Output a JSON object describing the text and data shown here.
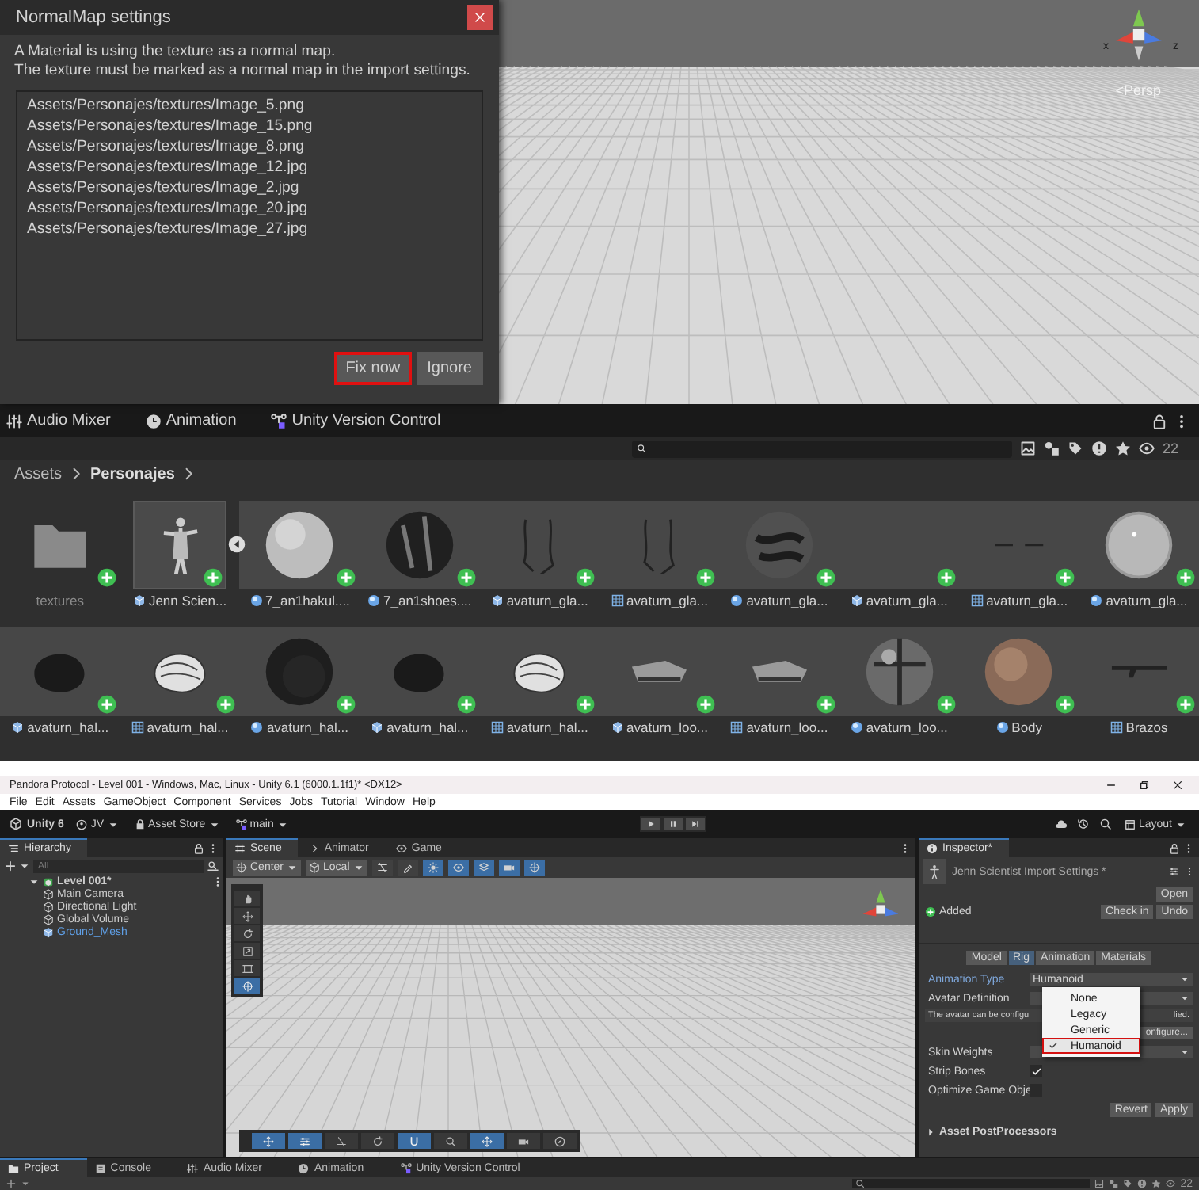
{
  "scene_preview": {
    "axis_labels": [
      "x",
      "z"
    ],
    "view_label": "<Persp"
  },
  "normal_map_dialog": {
    "title": "NormalMap settings",
    "message": [
      "A Material is using the texture as a normal map.",
      "The texture must be marked as a normal map in the import settings."
    ],
    "files": [
      "Assets/Personajes/textures/Image_5.png",
      "Assets/Personajes/textures/Image_15.png",
      "Assets/Personajes/textures/Image_8.png",
      "Assets/Personajes/textures/Image_12.jpg",
      "Assets/Personajes/textures/Image_2.jpg",
      "Assets/Personajes/textures/Image_20.jpg",
      "Assets/Personajes/textures/Image_27.jpg"
    ],
    "buttons": [
      {
        "label": "Fix now",
        "highlighted": true
      },
      {
        "label": "Ignore",
        "highlighted": false
      }
    ]
  },
  "project_panel": {
    "tabs": [
      {
        "label": "Audio Mixer"
      },
      {
        "label": "Animation"
      },
      {
        "label": "Unity Version Control"
      }
    ],
    "hidden_count": "22",
    "breadcrumb": [
      {
        "label": "Assets",
        "current": false
      },
      {
        "label": "Personajes",
        "current": true
      }
    ],
    "asset_rows": [
      [
        {
          "name": "textures",
          "kind": "folder",
          "grouped": false,
          "selected": false,
          "expanded": false
        },
        {
          "name": "Jenn Scien...",
          "kind": "prefab",
          "grouped": false,
          "selected": true,
          "expanded": true
        },
        {
          "name": "7_an1hakul....",
          "kind": "material",
          "grouped": true,
          "selected": false,
          "expanded": false
        },
        {
          "name": "7_an1shoes....",
          "kind": "material",
          "grouped": true,
          "selected": false,
          "expanded": false
        },
        {
          "name": "avaturn_gla...",
          "kind": "prefab",
          "grouped": true,
          "selected": false,
          "expanded": false
        },
        {
          "name": "avaturn_gla...",
          "kind": "texture",
          "grouped": true,
          "selected": false,
          "expanded": false
        },
        {
          "name": "avaturn_gla...",
          "kind": "material",
          "grouped": true,
          "selected": false,
          "expanded": false
        },
        {
          "name": "avaturn_gla...",
          "kind": "prefab",
          "grouped": true,
          "selected": false,
          "expanded": false
        },
        {
          "name": "avaturn_gla...",
          "kind": "texture",
          "grouped": true,
          "selected": false,
          "expanded": false
        },
        {
          "name": "avaturn_gla...",
          "kind": "material",
          "grouped": true,
          "selected": false,
          "expanded": false
        }
      ],
      [
        {
          "name": "avaturn_hal...",
          "kind": "prefab",
          "grouped": true,
          "selected": false,
          "expanded": false
        },
        {
          "name": "avaturn_hal...",
          "kind": "texture",
          "grouped": true,
          "selected": false,
          "expanded": false
        },
        {
          "name": "avaturn_hal...",
          "kind": "material",
          "grouped": true,
          "selected": false,
          "expanded": false
        },
        {
          "name": "avaturn_hal...",
          "kind": "prefab",
          "grouped": true,
          "selected": false,
          "expanded": false
        },
        {
          "name": "avaturn_hal...",
          "kind": "texture",
          "grouped": true,
          "selected": false,
          "expanded": false
        },
        {
          "name": "avaturn_loo...",
          "kind": "prefab",
          "grouped": true,
          "selected": false,
          "expanded": false
        },
        {
          "name": "avaturn_loo...",
          "kind": "texture",
          "grouped": true,
          "selected": false,
          "expanded": false
        },
        {
          "name": "avaturn_loo...",
          "kind": "material",
          "grouped": true,
          "selected": false,
          "expanded": false
        },
        {
          "name": "Body",
          "kind": "material",
          "grouped": true,
          "selected": false,
          "expanded": false
        },
        {
          "name": "Brazos",
          "kind": "texture",
          "grouped": true,
          "selected": false,
          "expanded": false
        }
      ]
    ]
  },
  "editor": {
    "title": "Pandora Protocol - Level 001 - Windows, Mac, Linux - Unity 6.1 (6000.1.1f1)* <DX12>",
    "menu": [
      "File",
      "Edit",
      "Assets",
      "GameObject",
      "Component",
      "Services",
      "Jobs",
      "Tutorial",
      "Window",
      "Help"
    ],
    "toolbar": {
      "version": "Unity 6",
      "account": "JV",
      "asset_store": "Asset Store",
      "branch": "main",
      "layout": "Layout"
    },
    "hierarchy": {
      "tab": "Hierarchy",
      "search_placeholder": "All",
      "tree": [
        {
          "label": "Level 001*",
          "expanded": true,
          "selected": false,
          "children": [
            {
              "label": "Main Camera",
              "selected": false
            },
            {
              "label": "Directional Light",
              "selected": false
            },
            {
              "label": "Global Volume",
              "selected": false
            },
            {
              "label": "Ground_Mesh",
              "selected": true
            }
          ]
        }
      ]
    },
    "scene": {
      "tabs": [
        {
          "label": "Scene",
          "selected": true
        },
        {
          "label": "Animator",
          "selected": false
        },
        {
          "label": "Game",
          "selected": false
        }
      ],
      "pivot": "Center",
      "space": "Local",
      "toggles": [
        {
          "on": false
        },
        {
          "on": false
        },
        {
          "on": true
        },
        {
          "on": true
        },
        {
          "on": true
        },
        {
          "on": true
        },
        {
          "on": true
        }
      ],
      "tool_palette": [
        {
          "selected": false
        },
        {
          "selected": false
        },
        {
          "selected": false
        },
        {
          "selected": false
        },
        {
          "selected": false
        },
        {
          "selected": true
        }
      ],
      "overlay_tools": [
        {
          "selected": true
        },
        {
          "selected": true
        },
        {
          "selected": false
        },
        {
          "selected": false
        },
        {
          "selected": true
        },
        {
          "selected": false
        },
        {
          "selected": true
        },
        {
          "selected": false
        },
        {
          "selected": false
        }
      ]
    },
    "inspector": {
      "tab": "Inspector*",
      "asset_title": "Jenn Scientist Import Settings *",
      "open_button": "Open",
      "vcs_status": "Added",
      "vcs_buttons": [
        "Check in",
        "Undo"
      ],
      "tabs": [
        {
          "label": "Model",
          "selected": false
        },
        {
          "label": "Rig",
          "selected": true
        },
        {
          "label": "Animation",
          "selected": false
        },
        {
          "label": "Materials",
          "selected": false
        }
      ],
      "fields": [
        {
          "kind": "dropdown",
          "label": "Animation Type",
          "value": "Humanoid",
          "focused": true
        },
        {
          "kind": "dropdown",
          "label": "Avatar Definition",
          "focused": false
        },
        {
          "kind": "note",
          "text": "The avatar can be configu",
          "tail": "lied."
        },
        {
          "kind": "button",
          "text": "onfigure..."
        },
        {
          "kind": "dropdown",
          "label": "Skin Weights",
          "focused": false
        },
        {
          "kind": "checkbox",
          "label": "Strip Bones",
          "checked": true
        },
        {
          "kind": "checkbox",
          "label": "Optimize Game Obje",
          "checked": false
        }
      ],
      "buttons": [
        "Revert",
        "Apply"
      ],
      "foldout": {
        "label": "Asset PostProcessors",
        "expanded": false
      },
      "popup": [
        {
          "label": "None",
          "selected": false,
          "highlighted": false
        },
        {
          "label": "Legacy",
          "selected": false,
          "highlighted": false
        },
        {
          "label": "Generic",
          "selected": false,
          "highlighted": false
        },
        {
          "label": "Humanoid",
          "selected": true,
          "highlighted": true
        }
      ]
    },
    "bottom": {
      "tabs": [
        {
          "label": "Project",
          "selected": true
        },
        {
          "label": "Console",
          "selected": false
        },
        {
          "label": "Audio Mixer",
          "selected": false
        },
        {
          "label": "Animation",
          "selected": false
        },
        {
          "label": "Unity Version Control",
          "selected": false
        }
      ],
      "hidden_count": "22"
    }
  }
}
